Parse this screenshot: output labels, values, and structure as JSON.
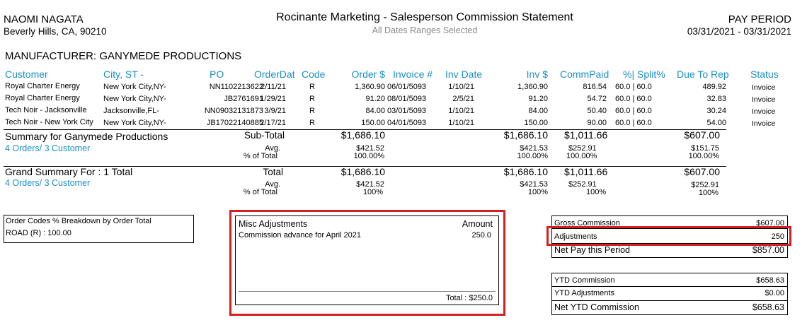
{
  "header": {
    "name": "NAOMI NAGATA",
    "address": "Beverly Hills, CA, 90210",
    "title": "Rocinante Marketing - Salesperson Commission Statement",
    "subtitle": "All Dates Ranges Selected",
    "pay_period_label": "PAY PERIOD",
    "pay_period_value": "03/31/2021 - 03/31/2021"
  },
  "manufacturer": "MANUFACTURER: GANYMEDE PRODUCTIONS",
  "columns": {
    "customer": "Customer",
    "city": "City, ST -",
    "po": "PO",
    "orderdate": "OrderDat",
    "code": "Code",
    "order": "Order $",
    "invoice": "Invoice #",
    "invdate": "Inv Date",
    "inv": "Inv $",
    "commpaid": "CommPaid",
    "split": "%| Split%",
    "due": "Due To Rep",
    "status": "Status"
  },
  "rows": [
    {
      "customer": "Royal Charter Energy",
      "city": "New York City,NY-",
      "po": "NN1102213622",
      "orderdate": "2/11/21",
      "code": "R",
      "order": "1,360.90",
      "invoice": "06/01/5093",
      "invdate": "1/10/21",
      "inv": "1,360.90",
      "commpaid": "816.54",
      "split": "60.0 | 60.0",
      "due": "489.92",
      "status": "Invoice"
    },
    {
      "customer": "Royal Charter Energy",
      "city": "New York City,NY-",
      "po": "JB2761691",
      "orderdate": "1/29/21",
      "code": "R",
      "order": "91.20",
      "invoice": "08/01/5093",
      "invdate": "2/5/21",
      "inv": "91.20",
      "commpaid": "54.72",
      "split": "60.0 | 60.0",
      "due": "32.83",
      "status": "Invoice"
    },
    {
      "customer": "Tech Noir - Jacksonville",
      "city": "Jacksonville,FL-",
      "po": "NN09032131873",
      "orderdate": "3/9/21",
      "code": "R",
      "order": "84.00",
      "invoice": "03/01/5093",
      "invdate": "1/10/21",
      "inv": "84.00",
      "commpaid": "50.40",
      "split": "60.0 | 60.0",
      "due": "30.24",
      "status": "Invoice"
    },
    {
      "customer": "Tech Noir - New York City",
      "city": "New York City,NY-",
      "po": "JB17022140885",
      "orderdate": "2/17/21",
      "code": "R",
      "order": "150.00",
      "invoice": "04/01/5093",
      "invdate": "1/10/21",
      "inv": "150.00",
      "commpaid": "90.00",
      "split": "60.0 | 60.0",
      "due": "54.00",
      "status": "Invoice"
    }
  ],
  "summary": {
    "title": "Summary for Ganymede Productions",
    "counts": "4 Orders/ 3 Customer",
    "subtotal_label": "Sub-Total",
    "avg_label": "Avg.",
    "pct_label": "% of Total",
    "order_total": "$1,686.10",
    "order_avg": "$421.52",
    "order_pct": "100.00%",
    "inv_total": "$1,686.10",
    "inv_avg": "$421.53",
    "inv_pct": "100.00%",
    "comm_total": "$1,011.66",
    "comm_avg": "$252.91",
    "comm_pct": "100.00%",
    "due_total": "$607.00",
    "due_avg": "$151.75",
    "due_pct": "100.00%"
  },
  "grand": {
    "title": "Grand Summary For : 1 Total",
    "counts": "4 Orders/ 3 Customer",
    "total_label": "Total",
    "avg_label": "Avg.",
    "pct_label": "% of Total",
    "order_total": "$1,686.10",
    "order_avg": "$421.52",
    "order_pct": "100%",
    "inv_total": "$1,686.10",
    "inv_avg": "$421.53",
    "inv_pct": "100%",
    "comm_total": "$1,011.66",
    "comm_avg": "$252.91",
    "comm_pct": "100%",
    "due_total": "$607.00",
    "due_avg": "$252.91",
    "due_pct": "100%"
  },
  "order_codes": {
    "title": "Order Codes % Breakdown by Order Total",
    "line": "ROAD (R) : 100.00"
  },
  "misc": {
    "title": "Misc Adjustments",
    "amount_label": "Amount",
    "item_desc": "Commission advance for April 2021",
    "item_amount": "250.0",
    "total": "Total : $250.0"
  },
  "pay": {
    "gross_label": "Gross Commission",
    "gross_value": "$607.00",
    "adj_label": "Adjustments",
    "adj_value": "250",
    "net_label": "Net Pay this Period",
    "net_value": "$857.00"
  },
  "ytd": {
    "comm_label": "YTD Commission",
    "comm_value": "$658.63",
    "adj_label": "YTD Adjustments",
    "adj_value": "$0.00",
    "net_label": "Net YTD Commission",
    "net_value": "$658.63"
  },
  "colors": {
    "header_blue": "#1a8fc4",
    "highlight_red": "#d42020"
  }
}
